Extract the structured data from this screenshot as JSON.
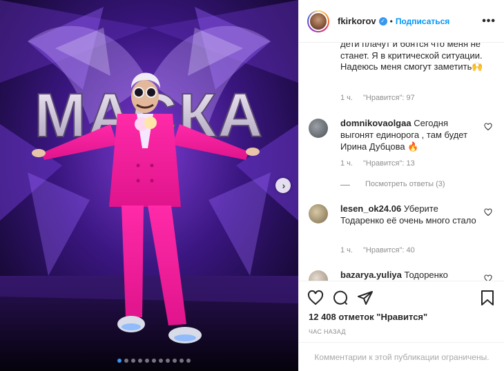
{
  "media": {
    "sign_text": "МАСКА",
    "dots_count": 11,
    "active_dot": 0,
    "next_icon": "chevron-right-icon"
  },
  "header": {
    "username": "fkirkorov",
    "separator": "•",
    "follow_label": "Подписаться",
    "more_label": "•••"
  },
  "comments": {
    "first_text": "дети плачут и боятся что меня не станет. Я в критической ситуации. Надеюсь меня смогут заметить🙌",
    "first_time": "1 ч.",
    "first_likes": "\"Нравится\": 97",
    "items": [
      {
        "user": "domnikovaolgaa",
        "text": "Сегодня выгонят единорога , там будет Ирина Дубцова 🔥",
        "time": "1 ч.",
        "likes": "\"Нравится\": 13",
        "replies": "Посмотреть ответы (3)"
      },
      {
        "user": "lesen_ok24.06",
        "text": "Уберите Тодаренко её очень много стало",
        "time": "1 ч.",
        "likes": "\"Нравится\": 40"
      },
      {
        "user": "bazarya.yuliya",
        "text": "Тодоренко"
      }
    ]
  },
  "actions": {
    "like_icon": "heart-icon",
    "comment_icon": "comment-icon",
    "share_icon": "share-icon",
    "save_icon": "bookmark-icon"
  },
  "likes_text": "12 408 отметок \"Нравится\"",
  "time_text": "ЧАС НАЗАД",
  "footer_text": "Комментарии к этой публикации ограничены."
}
